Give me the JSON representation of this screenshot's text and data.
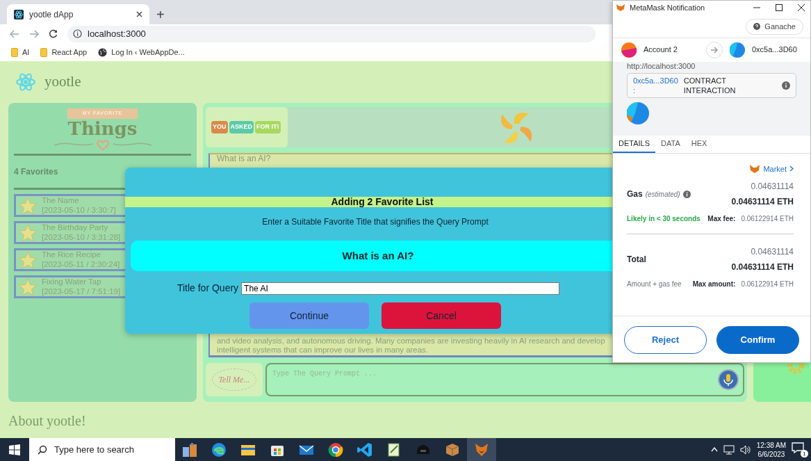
{
  "browser": {
    "tabs": [
      {
        "title": "yootle dApp",
        "selected": true
      }
    ],
    "new_tab": "+",
    "address": "localhost:3000",
    "bookmarks": [
      {
        "label": "AI",
        "kind": "folder"
      },
      {
        "label": "React App",
        "kind": "folder"
      },
      {
        "label": "Log In ‹ WebAppDe...",
        "kind": "site"
      }
    ]
  },
  "app": {
    "brand": "yootle",
    "favorites": {
      "banner": "MY FAVORITE",
      "title": "Things",
      "count": "4 Favorites",
      "items": [
        {
          "title": "The Name",
          "stamp": "[2023-05-10 / 3:30:7]"
        },
        {
          "title": "The Birthday Party",
          "stamp": "[2023-05-10 / 3:31:28]"
        },
        {
          "title": "The Rice Recipe",
          "stamp": "[2023-05-11 / 2:30:24]"
        },
        {
          "title": "Fixing Water Tap",
          "stamp": "[2023-05-17 / 7:51:19]"
        }
      ]
    },
    "chat": {
      "badge": [
        "YOU",
        "ASKED",
        "FOR IT!"
      ],
      "question": "What is an AI?",
      "answer_lines": [
        "and video analysis, and autonomous driving. Many companies are investing heavily in AI research and develop",
        "intelligent systems that can improve our lives in many areas."
      ],
      "prompt_label": "Tell Me...",
      "placeholder": "Type The Query Prompt ..."
    },
    "footer": "About yootle!"
  },
  "modal": {
    "title": "Adding 2 Favorite List",
    "subtitle": "Enter a Suitable Favorite Title that signifies the Query Prompt",
    "query": "What is an AI?",
    "field_label": "Title for Query",
    "field_value": "The AI",
    "buttons": [
      {
        "label": "Continue",
        "kind": "primary"
      },
      {
        "label": "Cancel",
        "kind": "danger"
      }
    ]
  },
  "metamask": {
    "title": "MetaMask Notification",
    "network": "Ganache",
    "from": "Account 2",
    "to": "0xc5a...3D60",
    "origin": "http://localhost:3000",
    "contract": {
      "address": "0xc5a...3D60",
      "colon": ":",
      "label": "CONTRACT INTERACTION"
    },
    "tabs": [
      {
        "label": "DETAILS",
        "selected": true
      },
      {
        "label": "DATA",
        "selected": false
      },
      {
        "label": "HEX",
        "selected": false
      }
    ],
    "market": "Market",
    "gas": {
      "label": "Gas",
      "note": "(estimated)",
      "fiat": "0.04631114",
      "amount": "0.04631114 ETH",
      "speed": "Likely in < 30 seconds",
      "max_label": "Max fee:",
      "max_value": "0.06122914 ETH"
    },
    "total": {
      "label": "Total",
      "fiat": "0.04631114",
      "amount": "0.04631114 ETH",
      "note": "Amount + gas fee",
      "max_label": "Max amount:",
      "max_value": "0.06122914 ETH"
    },
    "buttons": [
      {
        "label": "Reject",
        "kind": "secondary"
      },
      {
        "label": "Confirm",
        "kind": "primary"
      }
    ]
  },
  "taskbar": {
    "search": "Type here to search",
    "apps": [
      {
        "kind": "photos",
        "selected": false
      },
      {
        "kind": "edge",
        "selected": false
      },
      {
        "kind": "files",
        "selected": false
      },
      {
        "kind": "store",
        "selected": false
      },
      {
        "kind": "mail",
        "selected": false
      },
      {
        "kind": "chrome",
        "selected": false
      },
      {
        "kind": "code",
        "selected": false
      },
      {
        "kind": "notepad",
        "selected": false
      },
      {
        "kind": "helmet",
        "selected": false
      },
      {
        "kind": "box",
        "selected": false
      },
      {
        "kind": "fox",
        "selected": true
      }
    ],
    "time": "12:38 AM",
    "date": "6/6/2023",
    "notifications": "1"
  }
}
